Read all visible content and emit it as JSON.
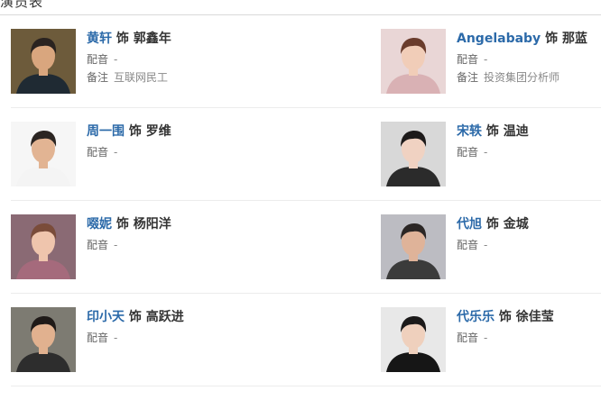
{
  "section": {
    "title": "演员表"
  },
  "cast": [
    {
      "actor": "黄轩",
      "connector": "饰",
      "role": "郭鑫年",
      "voice_label": "配音",
      "voice_value": "-",
      "note_label": "备注",
      "note_value": "互联网民工",
      "skin": "#d9a67e",
      "hair": "#2a2320",
      "shirt": "#1f2a33",
      "bg": "#6d5b3b"
    },
    {
      "actor": "Angelababy",
      "connector": "饰",
      "role": "那蓝",
      "voice_label": "配音",
      "voice_value": "-",
      "note_label": "备注",
      "note_value": "投资集团分析师",
      "skin": "#f1cdb8",
      "hair": "#6a3c2c",
      "shirt": "#d9b1b4",
      "bg": "#e9d6d6"
    },
    {
      "actor": "周一围",
      "connector": "饰",
      "role": "罗维",
      "voice_label": "配音",
      "voice_value": "-",
      "skin": "#e2b493",
      "hair": "#2b2522",
      "shirt": "#f4f4f4",
      "bg": "#f6f6f6"
    },
    {
      "actor": "宋轶",
      "connector": "饰",
      "role": "温迪",
      "voice_label": "配音",
      "voice_value": "-",
      "skin": "#f0d2c2",
      "hair": "#1d1a1a",
      "shirt": "#2b2b2b",
      "bg": "#d8d8d8"
    },
    {
      "actor": "啜妮",
      "connector": "饰",
      "role": "杨阳洋",
      "voice_label": "配音",
      "voice_value": "-",
      "skin": "#efc5ad",
      "hair": "#7a4c3a",
      "shirt": "#a56a7c",
      "bg": "#8a6a74"
    },
    {
      "actor": "代旭",
      "connector": "饰",
      "role": "金城",
      "voice_label": "配音",
      "voice_value": "-",
      "skin": "#dfb399",
      "hair": "#2b2625",
      "shirt": "#3b3b3b",
      "bg": "#bcbcc2"
    },
    {
      "actor": "印小天",
      "connector": "饰",
      "role": "高跃进",
      "voice_label": "配音",
      "voice_value": "-",
      "skin": "#e1b18f",
      "hair": "#1f1a18",
      "shirt": "#2d2d2d",
      "bg": "#7d7b72"
    },
    {
      "actor": "代乐乐",
      "connector": "饰",
      "role": "徐佳莹",
      "voice_label": "配音",
      "voice_value": "-",
      "skin": "#efd0bd",
      "hair": "#1b1919",
      "shirt": "#161616",
      "bg": "#e8e8e8"
    }
  ]
}
